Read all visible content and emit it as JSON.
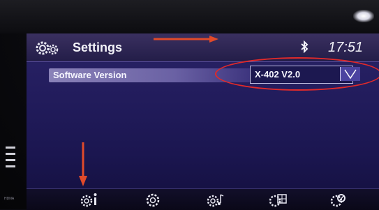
{
  "header": {
    "title": "Settings",
    "settings_icon": "gear-icon",
    "bluetooth_icon": "bluetooth-icon",
    "time": "17:51"
  },
  "settings": {
    "software_version": {
      "label": "Software Version",
      "value": "X-402 V2.0",
      "dropdown_icon": "chevron-down-icon"
    }
  },
  "bottom_tabs": [
    {
      "name": "info",
      "icon": "info-gear-icon"
    },
    {
      "name": "settings",
      "icon": "gear-icon"
    },
    {
      "name": "audio",
      "icon": "music-gear-icon"
    },
    {
      "name": "display",
      "icon": "display-gear-icon"
    },
    {
      "name": "sound",
      "icon": "equalizer-gear-icon"
    }
  ],
  "bezel": {
    "brand_label": "HDNA"
  },
  "colors": {
    "screen_bg": "#221c5c",
    "header_text": "#f2f2f8",
    "annotation": "#e12a2a",
    "row_highlight": "#8a82b8"
  }
}
